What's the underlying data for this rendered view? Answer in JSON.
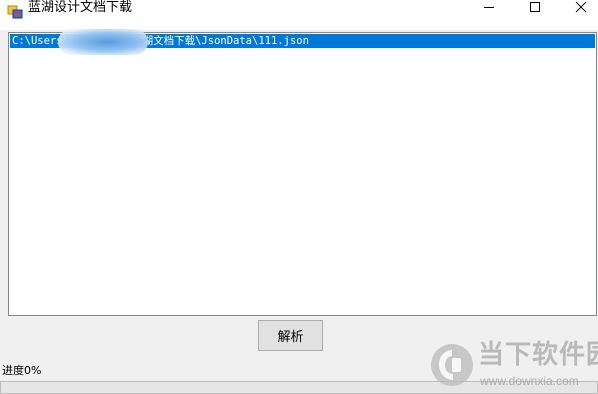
{
  "window": {
    "title": "蓝湖设计文档下载"
  },
  "path_list": {
    "items": [
      {
        "text": "C:\\Users\\        \\Desktop\\蓝湖文档下载\\JsonData\\111.json",
        "selected": true
      }
    ]
  },
  "actions": {
    "parse_label": "解析"
  },
  "progress": {
    "label": "进度0%",
    "value": 0
  },
  "watermark": {
    "name": "当下软件园",
    "url": "www.downxia.com"
  },
  "colors": {
    "selection": "#0078d7",
    "window_bg": "#f0f0f0",
    "button_bg": "#e1e1e1",
    "progress_fill": "#06b025"
  },
  "icons": {
    "app": "app-window-icon",
    "minimize": "minimize-icon",
    "maximize": "maximize-icon",
    "close": "close-icon",
    "watermark_logo": "downxia-logo-icon"
  }
}
